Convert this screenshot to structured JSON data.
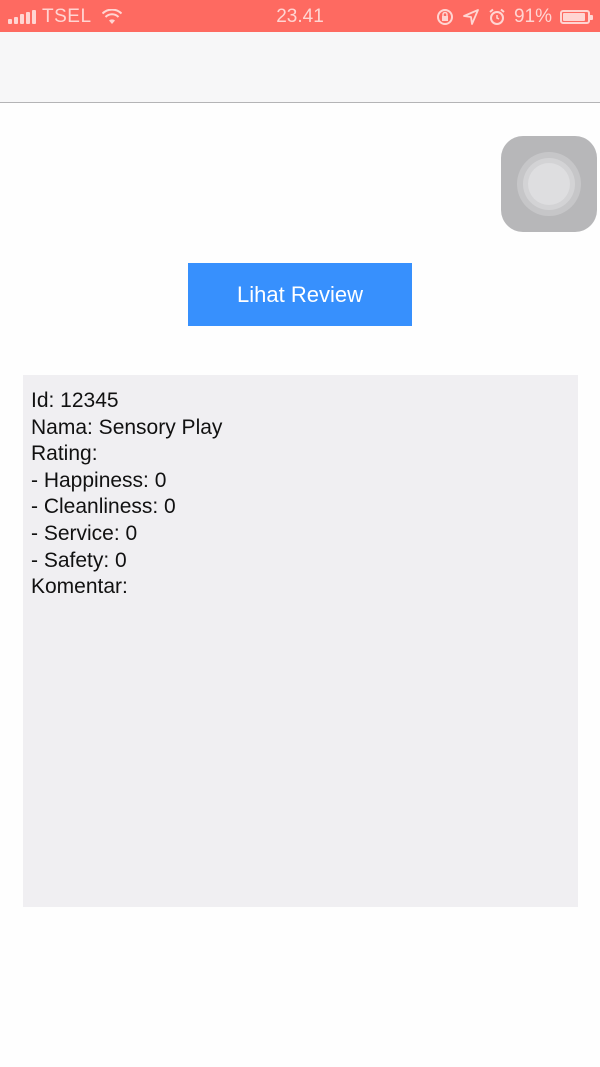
{
  "status_bar": {
    "carrier": "TSEL",
    "time": "23.41",
    "battery_percent_text": "91%",
    "battery_level": 0.91,
    "icons": [
      "signal-icon",
      "wifi-icon",
      "screen-lock-icon",
      "location-icon",
      "alarm-icon",
      "battery-icon"
    ],
    "color": "#fe6a61"
  },
  "button": {
    "label": "Lihat Review",
    "color": "#3790fd"
  },
  "details": {
    "id": "Id: 12345",
    "nama": "Nama: Sensory Play",
    "rating": "Rating:",
    "happiness": "- Happiness: 0",
    "cleanliness": "- Cleanliness: 0",
    "service": "- Service: 0",
    "safety": "- Safety: 0",
    "komentar": "Komentar:"
  }
}
